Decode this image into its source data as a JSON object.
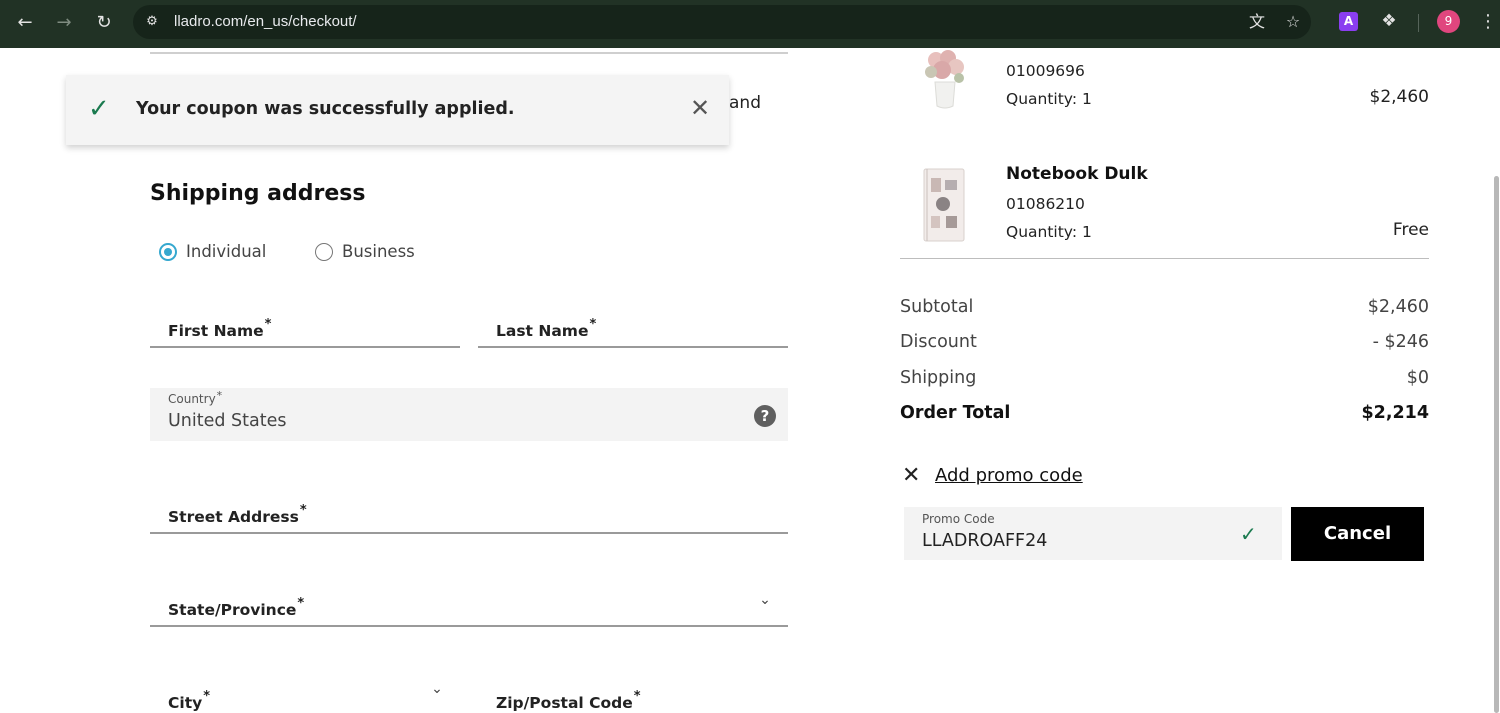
{
  "browser": {
    "url": "lladro.com/en_us/checkout/",
    "profile_initial": "9",
    "extension_label": "A",
    "icons": [
      "back-icon",
      "forward-icon",
      "reload-icon",
      "site-info-icon",
      "translate-icon",
      "star-icon",
      "extensions-icon",
      "menu-icon"
    ]
  },
  "page": {
    "and_fragment": "and"
  },
  "toast": {
    "message": "Your coupon was successfully applied.",
    "icon": "check-icon",
    "close_icon": "close-icon"
  },
  "shipping": {
    "title": "Shipping address",
    "customer_type": {
      "options": [
        "Individual",
        "Business"
      ],
      "selected": "Individual"
    },
    "fields": {
      "first_name": "First Name",
      "last_name": "Last Name",
      "country_label": "Country",
      "country_value": "United States",
      "street": "Street Address",
      "state": "State/Province",
      "city": "City",
      "zip": "Zip/Postal Code",
      "required_mark": "*"
    }
  },
  "cart": {
    "items": [
      {
        "name": "",
        "sku": "01009696",
        "quantity": "Quantity: 1",
        "price": "$2,460"
      },
      {
        "name": "Notebook Dulk",
        "sku": "01086210",
        "quantity": "Quantity: 1",
        "price": "Free"
      }
    ]
  },
  "summary": {
    "subtotal_label": "Subtotal",
    "subtotal_value": "$2,460",
    "discount_label": "Discount",
    "discount_value": "- $246",
    "shipping_label": "Shipping",
    "shipping_value": "$0",
    "total_label": "Order Total",
    "total_value": "$2,214"
  },
  "promo": {
    "toggle_label": "Add promo code",
    "input_label": "Promo Code",
    "input_value": "LLADROAFF24",
    "cancel_label": "Cancel"
  },
  "colors": {
    "chrome_bg": "#213225",
    "accent_radio": "#35a8cf",
    "success_green": "#1a7a4f",
    "button_bg": "#000000"
  }
}
